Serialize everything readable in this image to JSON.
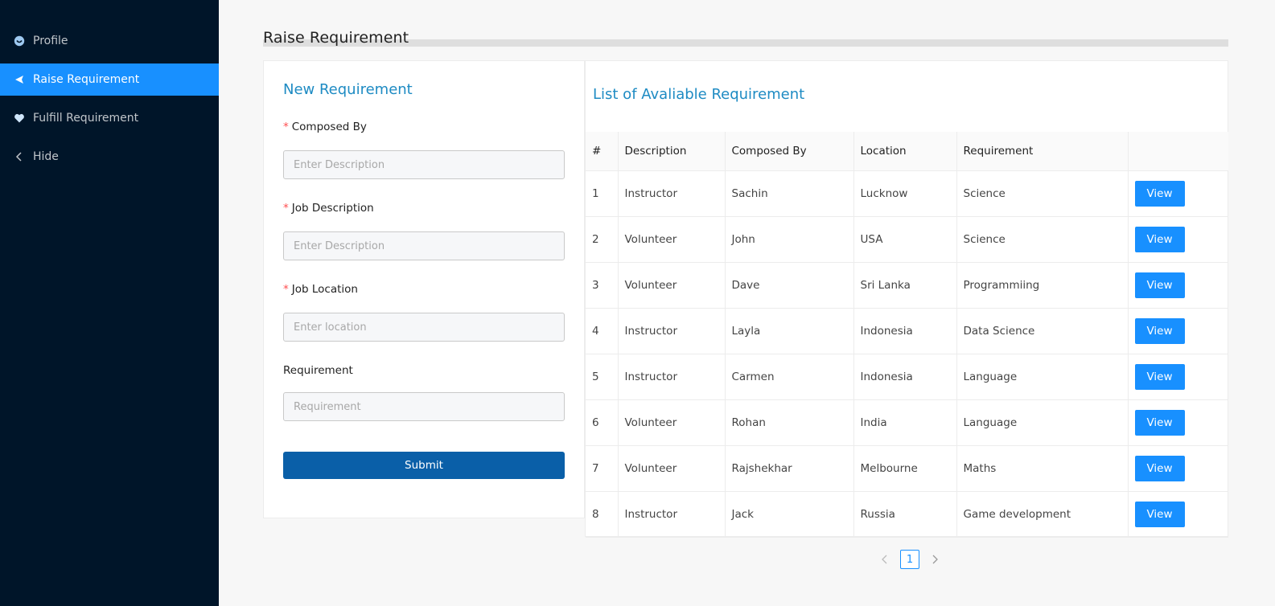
{
  "sidebar": {
    "items": [
      {
        "label": "Profile",
        "icon": "smile-icon",
        "active": false
      },
      {
        "label": "Raise Requirement",
        "icon": "send-icon",
        "active": true
      },
      {
        "label": "Fulfill Requirement",
        "icon": "heart-icon",
        "active": false
      },
      {
        "label": "Hide",
        "icon": "chevron-left-icon",
        "active": false
      }
    ]
  },
  "page": {
    "title": "Raise Requirement"
  },
  "form": {
    "title": "New Requirement",
    "composed_by": {
      "label": "Composed By",
      "placeholder": "Enter Description",
      "required": true
    },
    "job_description": {
      "label": "Job Description",
      "placeholder": "Enter Description",
      "required": true
    },
    "job_location": {
      "label": "Job Location",
      "placeholder": "Enter location",
      "required": true
    },
    "requirement": {
      "label": "Requirement",
      "placeholder": "Requirement",
      "required": false
    },
    "submit_label": "Submit",
    "required_mark": "*"
  },
  "table": {
    "title": "List of Avaliable Requirement",
    "columns": [
      "#",
      "Description",
      "Composed By",
      "Location",
      "Requirement",
      ""
    ],
    "view_label": "View",
    "rows": [
      {
        "num": "1",
        "description": "Instructor",
        "composed_by": "Sachin",
        "location": "Lucknow",
        "requirement": "Science"
      },
      {
        "num": "2",
        "description": "Volunteer",
        "composed_by": "John",
        "location": "USA",
        "requirement": "Science"
      },
      {
        "num": "3",
        "description": "Volunteer",
        "composed_by": "Dave",
        "location": "Sri Lanka",
        "requirement": "Programmiing"
      },
      {
        "num": "4",
        "description": "Instructor",
        "composed_by": "Layla",
        "location": "Indonesia",
        "requirement": "Data Science"
      },
      {
        "num": "5",
        "description": "Instructor",
        "composed_by": "Carmen",
        "location": "Indonesia",
        "requirement": "Language"
      },
      {
        "num": "6",
        "description": "Volunteer",
        "composed_by": "Rohan",
        "location": "India",
        "requirement": "Language"
      },
      {
        "num": "7",
        "description": "Volunteer",
        "composed_by": "Rajshekhar",
        "location": "Melbourne",
        "requirement": "Maths"
      },
      {
        "num": "8",
        "description": "Instructor",
        "composed_by": "Jack",
        "location": "Russia",
        "requirement": "Game development"
      }
    ]
  },
  "pagination": {
    "current_page": "1",
    "prev_icon": "chevron-left-icon",
    "next_icon": "chevron-right-icon"
  },
  "colors": {
    "sidebar_bg": "#001529",
    "active_item": "#1890ff",
    "heading": "#1e8bc3",
    "submit": "#0a5fa8",
    "view_button": "#1890ff",
    "required": "#ff4d4f"
  }
}
